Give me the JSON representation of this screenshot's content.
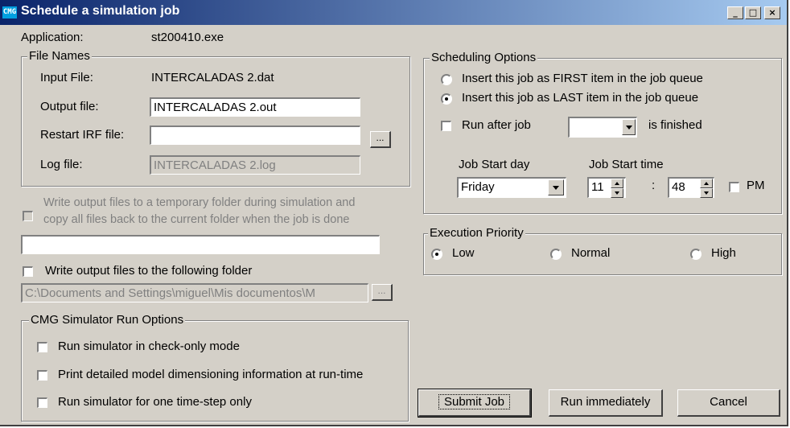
{
  "window": {
    "title": "Schedule a simulation job",
    "icon_text": "CMG",
    "titlebar_buttons": {
      "minimize": "_",
      "maximize": "□",
      "close": "×"
    }
  },
  "application": {
    "label": "Application:",
    "value": "st200410.exe"
  },
  "file_names": {
    "legend": "File Names",
    "input_label": "Input File:",
    "input_value": "INTERCALADAS 2.dat",
    "output_label": "Output file:",
    "output_value": "INTERCALADAS 2.out",
    "restart_label": "Restart IRF file:",
    "restart_value": "",
    "browse_label": "...",
    "log_label": "Log file:",
    "log_value": "INTERCALADAS 2.log"
  },
  "temp_folder": {
    "label_line1": "Write output files to a temporary folder during simulation and",
    "label_line2": "copy all files back to the current folder when the job is done",
    "value": ""
  },
  "output_folder": {
    "label": "Write output files to the following folder",
    "value": "C:\\Documents and Settings\\miguel\\Mis documentos\\M",
    "browse_label": "..."
  },
  "run_options": {
    "legend": "CMG Simulator Run Options",
    "opt1": "Run simulator in check-only mode",
    "opt2": "Print detailed model dimensioning information at run-time",
    "opt3": "Run simulator for one time-step only"
  },
  "scheduling": {
    "legend": "Scheduling Options",
    "first_label": "Insert this job as FIRST item in the job queue",
    "last_label": "Insert this job as LAST item in the job queue",
    "run_after_label": "Run after job",
    "run_after_value": "",
    "is_finished": "is finished",
    "start_day_label": "Job Start day",
    "start_day_value": "Friday",
    "start_time_label": "Job Start time",
    "hour": "11",
    "colon": ":",
    "minute": "48",
    "pm_label": "PM"
  },
  "priority": {
    "legend": "Execution Priority",
    "low": "Low",
    "normal": "Normal",
    "high": "High"
  },
  "buttons": {
    "submit": "Submit Job",
    "run_now": "Run immediately",
    "cancel": "Cancel"
  }
}
